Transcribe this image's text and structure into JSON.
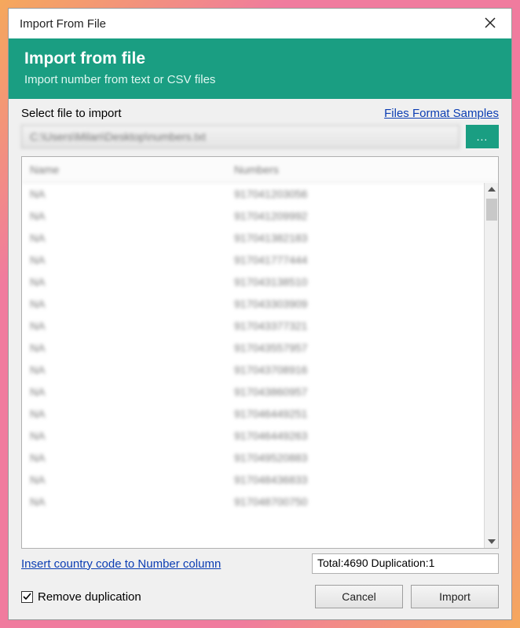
{
  "window": {
    "title": "Import From File"
  },
  "header": {
    "title": "Import from file",
    "subtitle": "Import number from text or CSV files"
  },
  "fileSelect": {
    "label": "Select file to import",
    "samplesLink": "Files Format Samples",
    "path": "C:\\Users\\Milan\\Desktop\\numbers.txt",
    "browseLabel": "..."
  },
  "table": {
    "columns": {
      "name": "Name",
      "numbers": "Numbers"
    },
    "rows": [
      {
        "name": "NA",
        "number": "917041203056"
      },
      {
        "name": "NA",
        "number": "917041209992"
      },
      {
        "name": "NA",
        "number": "917041382183"
      },
      {
        "name": "NA",
        "number": "917041777444"
      },
      {
        "name": "NA",
        "number": "917043138510"
      },
      {
        "name": "NA",
        "number": "917043303909"
      },
      {
        "name": "NA",
        "number": "917043377321"
      },
      {
        "name": "NA",
        "number": "917043557957"
      },
      {
        "name": "NA",
        "number": "917043708916"
      },
      {
        "name": "NA",
        "number": "917043860957"
      },
      {
        "name": "NA",
        "number": "917046449251"
      },
      {
        "name": "NA",
        "number": "917046449263"
      },
      {
        "name": "NA",
        "number": "917049520883"
      },
      {
        "name": "NA",
        "number": "917048436833"
      },
      {
        "name": "NA",
        "number": "917048700750"
      }
    ]
  },
  "footer": {
    "countryLink": "Insert country code to Number column",
    "status": "Total:4690 Duplication:1",
    "removeDup": {
      "label": "Remove duplication",
      "checked": true
    },
    "cancel": "Cancel",
    "import": "Import"
  }
}
